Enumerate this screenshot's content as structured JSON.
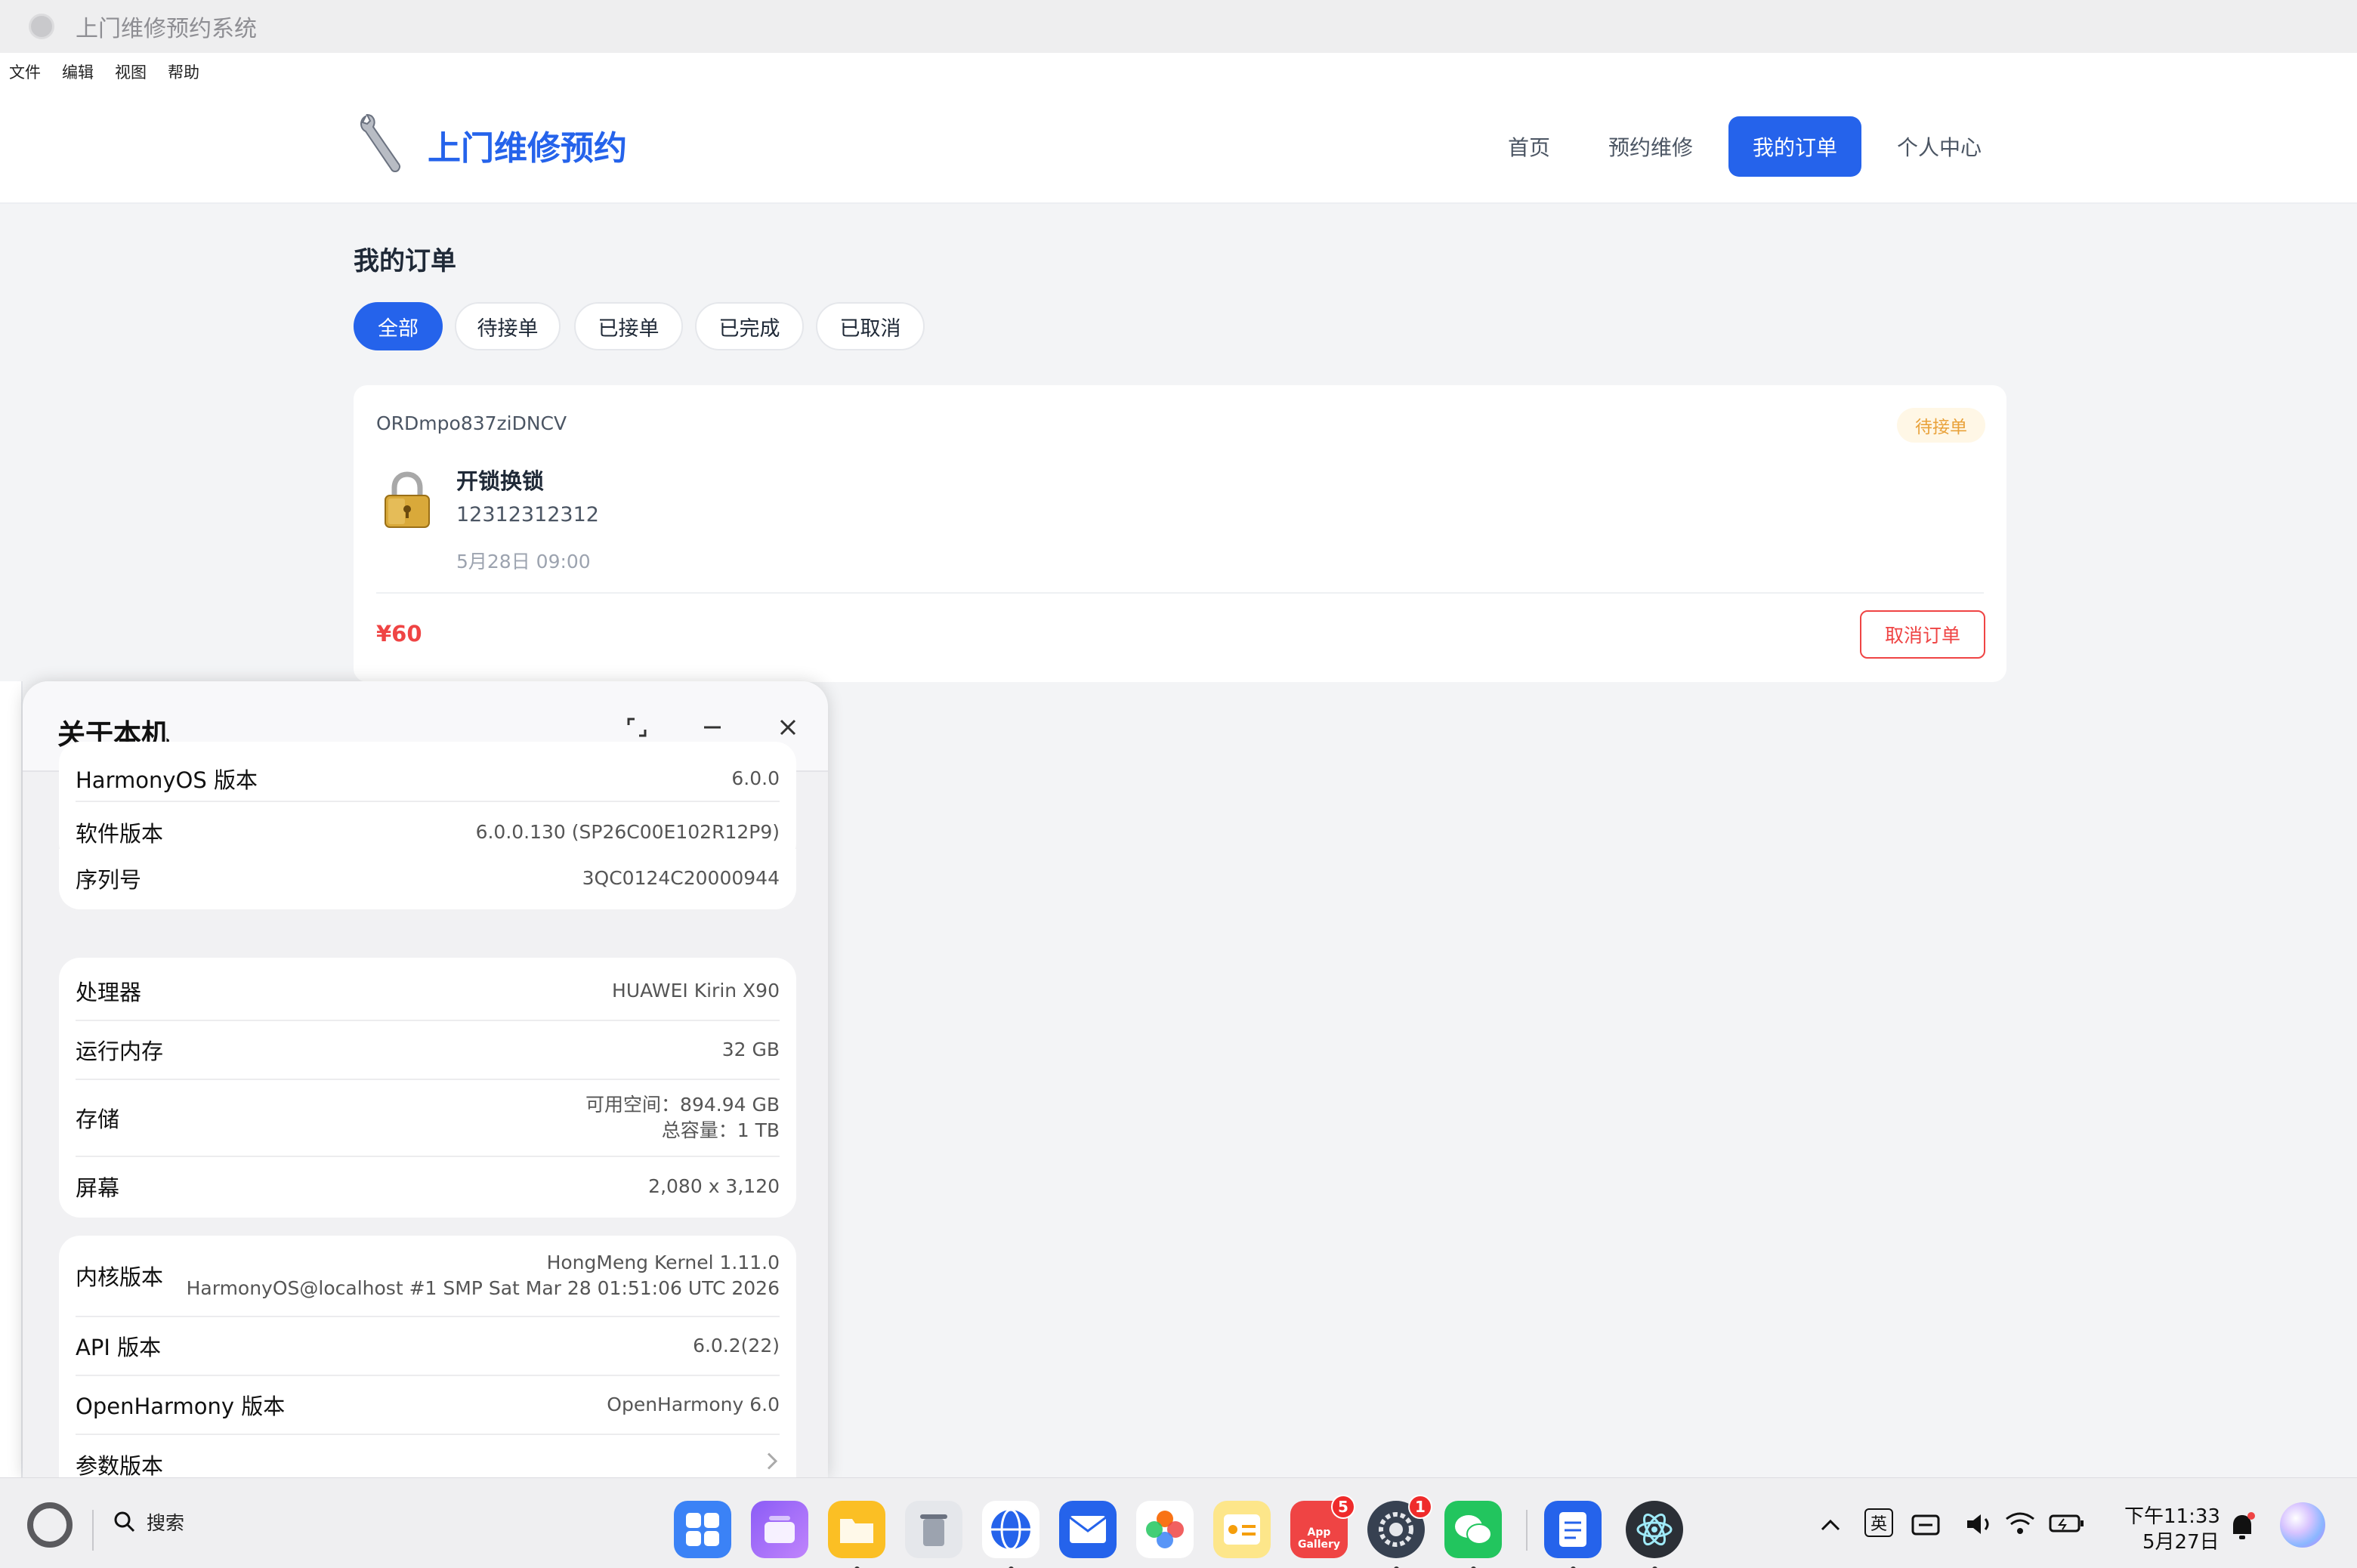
{
  "window": {
    "title": "上门维修预约系统"
  },
  "menubar": {
    "items": [
      "文件",
      "编辑",
      "视图",
      "帮助"
    ]
  },
  "header": {
    "logo_text": "上门维修预约",
    "nav": {
      "home": "首页",
      "book": "预约维修",
      "orders": "我的订单",
      "profile": "个人中心"
    },
    "active_nav": "我的订单"
  },
  "orders_page": {
    "title": "我的订单",
    "filters": {
      "all": "全部",
      "pending": "待接单",
      "accepted": "已接单",
      "completed": "已完成",
      "cancelled": "已取消"
    },
    "active_filter": "全部",
    "order": {
      "id": "ORDmpo837ziDNCV",
      "status": "待接单",
      "service": "开锁换锁",
      "phone": "12312312312",
      "time": "5月28日 09:00",
      "price": "¥60",
      "cancel_label": "取消订单"
    }
  },
  "about": {
    "title": "关于本机",
    "harmonyos_label": "HarmonyOS 版本",
    "harmonyos_value": "6.0.0",
    "software_label": "软件版本",
    "software_value": "6.0.0.130 (SP26C00E102R12P9)",
    "serial_label": "序列号",
    "serial_value": "3QC0124C20000944",
    "cpu_label": "处理器",
    "cpu_value": "HUAWEI Kirin X90",
    "ram_label": "运行内存",
    "ram_value": "32 GB",
    "storage_label": "存储",
    "storage_avail": "可用空间：894.94 GB",
    "storage_total": "总容量：1 TB",
    "screen_label": "屏幕",
    "screen_value": "2,080 x 3,120",
    "kernel_label": "内核版本",
    "kernel_line1": "HongMeng Kernel 1.11.0",
    "kernel_line2": "HarmonyOS@localhost #1 SMP Sat Mar 28 01:51:06 UTC 2026",
    "api_label": "API 版本",
    "api_value": "6.0.2(22)",
    "openharmony_label": "OpenHarmony 版本",
    "openharmony_value": "OpenHarmony 6.0",
    "params_label": "参数版本"
  },
  "taskbar": {
    "search_label": "搜索",
    "appgallery_text": "App Gallery",
    "appgallery_badge": "5",
    "settings_badge": "1",
    "ime_label": "英",
    "time": "下午11:33",
    "date": "5月27日"
  }
}
